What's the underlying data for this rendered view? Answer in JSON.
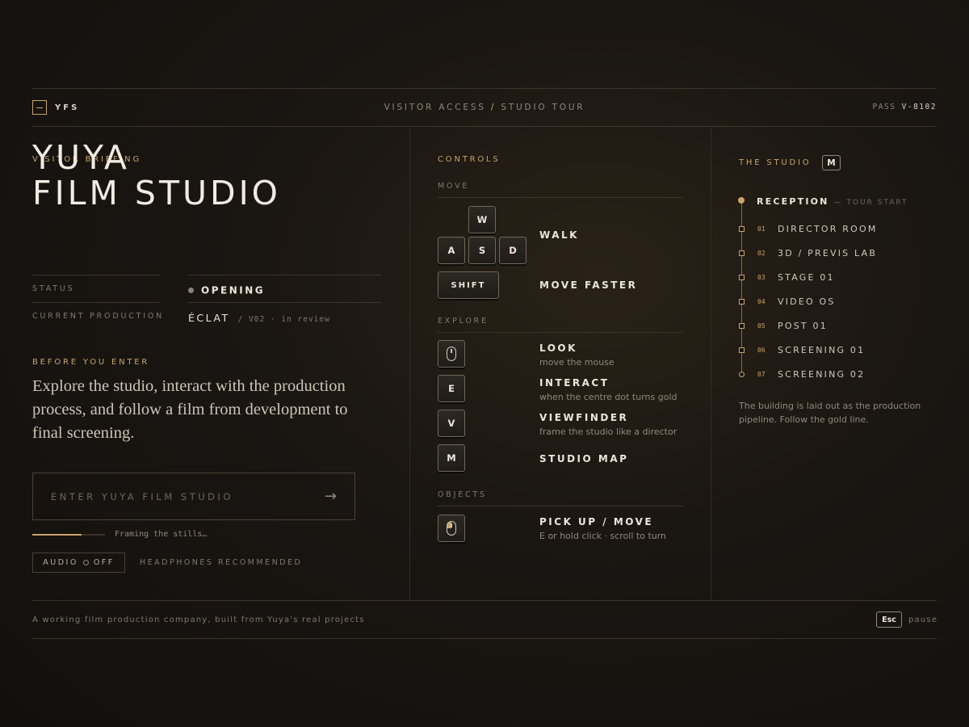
{
  "header": {
    "brand": "YFS",
    "breadcrumb_left": "VISITOR ACCESS",
    "breadcrumb_sep": "/",
    "breadcrumb_right": "STUDIO TOUR",
    "pass_label": "PASS",
    "pass_id": "V-8102"
  },
  "briefing": {
    "eyebrow": "VISITOR BRIEFING",
    "title_line1": "YUYA",
    "title_line2": "FILM STUDIO",
    "status_label": "STATUS",
    "status_value": "OPENING",
    "production_label": "CURRENT PRODUCTION",
    "production_value": "ÉCLAT",
    "production_meta": "/ V02 · in review",
    "before_label": "BEFORE YOU ENTER",
    "description": "Explore the studio, interact with the production process, and follow a film from development to final screening.",
    "enter_label": "ENTER YUYA FILM STUDIO",
    "loading_text": "Framing the stills…",
    "loading_progress": 0.68,
    "audio_label": "AUDIO",
    "audio_state": "OFF",
    "headphones": "HEADPHONES RECOMMENDED"
  },
  "controls": {
    "title": "CONTROLS",
    "move_section": "MOVE",
    "keys": {
      "w": "W",
      "a": "A",
      "s": "S",
      "d": "D",
      "shift": "SHIFT",
      "e": "E",
      "v": "V",
      "m": "M"
    },
    "walk": "WALK",
    "move_faster": "MOVE FASTER",
    "explore_section": "EXPLORE",
    "look": "LOOK",
    "look_desc": "move the mouse",
    "interact": "INTERACT",
    "interact_desc": "when the centre dot turns gold",
    "viewfinder": "VIEWFINDER",
    "viewfinder_desc": "frame the studio like a director",
    "studio_map": "STUDIO MAP",
    "objects_section": "OBJECTS",
    "pickup": "PICK UP / MOVE",
    "pickup_desc": "E or hold click · scroll to turn"
  },
  "studio": {
    "title": "THE STUDIO",
    "map_key": "M",
    "stops": [
      {
        "num": "",
        "name": "RECEPTION",
        "sub": "— TOUR START"
      },
      {
        "num": "01",
        "name": "DIRECTOR ROOM"
      },
      {
        "num": "02",
        "name": "3D / PREVIS LAB"
      },
      {
        "num": "03",
        "name": "STAGE 01"
      },
      {
        "num": "04",
        "name": "VIDEO OS"
      },
      {
        "num": "05",
        "name": "POST 01"
      },
      {
        "num": "06",
        "name": "SCREENING 01"
      },
      {
        "num": "07",
        "name": "SCREENING 02"
      }
    ],
    "note": "The building is laid out as the production pipeline. Follow the gold line."
  },
  "footer": {
    "tagline": "A working film production company, built from Yuya's real projects",
    "esc_key": "Esc",
    "esc_action": "pause"
  },
  "colors": {
    "accent_gold": "#c9a46a",
    "background": "#12100d",
    "text": "#e8e2d6"
  }
}
